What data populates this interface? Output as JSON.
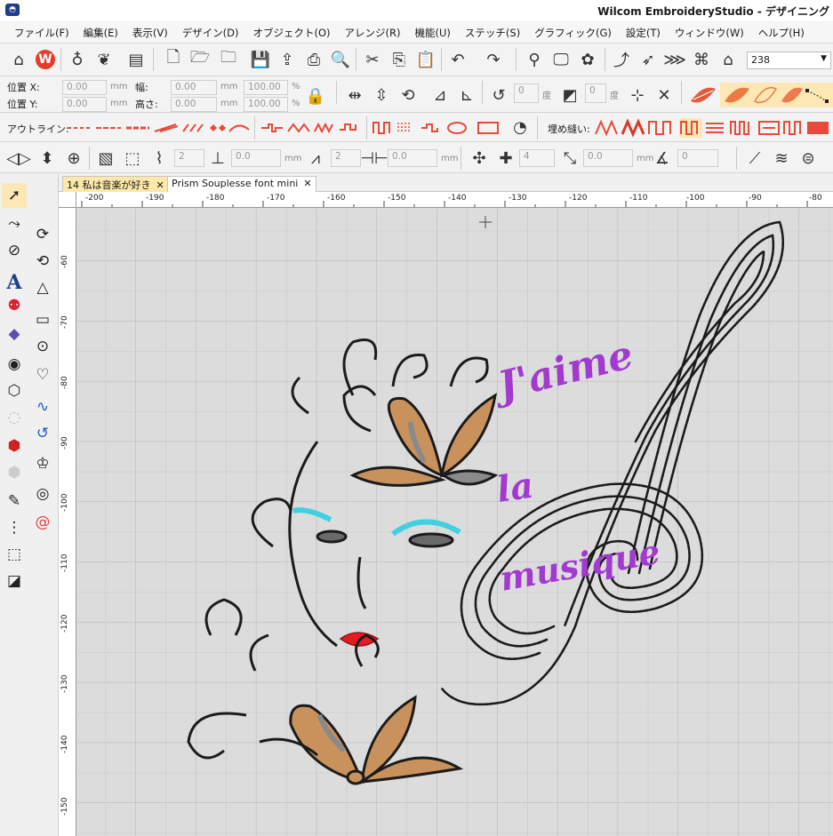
{
  "window": {
    "title": "Wilcom EmbroideryStudio - デザイニング",
    "app_icon": "app-logo-icon"
  },
  "menu": [
    "ファイル(F)",
    "編集(E)",
    "表示(V)",
    "デザイン(D)",
    "オブジェクト(O)",
    "アレンジ(R)",
    "機能(U)",
    "ステッチ(S)",
    "グラフィック(G)",
    "設定(T)",
    "ウィンドウ(W)",
    "ヘルプ(H)"
  ],
  "toolbar": {
    "zoom_value": "238"
  },
  "props": {
    "pos_x_label": "位置 X:",
    "pos_y_label": "位置 Y:",
    "pos_x": "0.00",
    "pos_y": "0.00",
    "unit": "mm",
    "width_label": "幅:",
    "height_label": "高さ:",
    "width": "0.00",
    "height": "0.00",
    "scale_w": "100.00",
    "scale_h": "100.00",
    "percent": "%",
    "rotate_val": "0",
    "skew_val": "0",
    "deg": "度"
  },
  "stitch_bar": {
    "outline_label": "アウトライン:",
    "fill_label": "埋め縫い:"
  },
  "param_bar": {
    "v1": "2",
    "v2": "0.0",
    "v3": "2",
    "v4": "0.0",
    "v5": "4",
    "v6": "0.0",
    "v7": "0",
    "mm": "mm"
  },
  "tabs": [
    {
      "label": "14 私は音楽が好き",
      "active": true
    },
    {
      "label": "Prism Souplesse font mini",
      "active": false
    }
  ],
  "ruler": {
    "top_ticks": [
      "-200",
      "-190",
      "-180",
      "-170",
      "-160",
      "-150",
      "-140",
      "-130",
      "-120",
      "-110",
      "-100",
      "-90",
      "-80"
    ],
    "left_ticks": [
      "-60",
      "-70",
      "-80",
      "-90",
      "-100",
      "-110",
      "-120",
      "-130",
      "-140",
      "-150"
    ]
  },
  "design": {
    "text_lines": [
      "J'aime",
      "la",
      "musique"
    ],
    "colors": {
      "thread_black": "#1b1b1b",
      "thread_purple": "#a23ad0",
      "thread_cyan": "#40d0e0",
      "thread_red": "#e31b23",
      "thread_tan": "#c9925c",
      "thread_grey": "#8a8a8a"
    }
  },
  "colors": {
    "tab_active": "#fce8a8",
    "canvas": "#dcdcdc",
    "grid": "#b8b8b8"
  }
}
